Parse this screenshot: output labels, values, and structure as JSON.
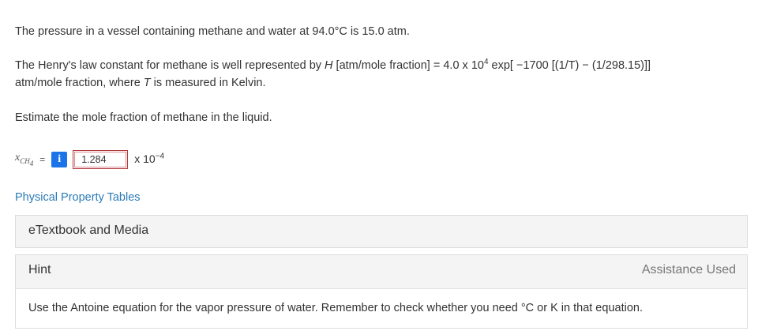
{
  "question": {
    "line1": "The pressure in a vessel containing methane and water at 94.0°C is 15.0 atm.",
    "line2_a": "The Henry's law constant for methane is well represented by ",
    "line2_H": "H",
    "line2_b": " [atm/mole fraction] = 4.0 x 10",
    "line2_exp": "4",
    "line2_c": " exp[ −1700 [(1/T) − (1/298.15)]]",
    "line2_d": "atm/mole fraction, where ",
    "line2_T": "T",
    "line2_e": " is measured in Kelvin.",
    "line3": "Estimate the mole fraction of methane in the liquid."
  },
  "answer": {
    "var_main": "x",
    "var_sub": "CH",
    "var_subsub": "4",
    "equals": "=",
    "info_icon_glyph": "i",
    "value": "1.284",
    "unit_prefix": "x 10",
    "unit_exp": "−4",
    "box_border_color": "#b4363c",
    "info_color": "#1a73e8"
  },
  "links": {
    "tables": "Physical Property Tables"
  },
  "panels": {
    "etext": "eTextbook and Media",
    "hint_title": "Hint",
    "assistance": "Assistance Used",
    "hint_body": "Use the Antoine equation for the vapor pressure of water. Remember to check whether you need °C or K in that equation."
  }
}
